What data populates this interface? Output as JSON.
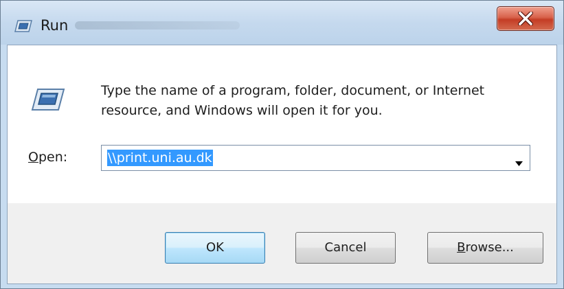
{
  "window": {
    "title": "Run"
  },
  "dialog": {
    "description_line1": "Type the name of a program, folder, document, or Internet",
    "description_line2": "resource, and Windows will open it for you.",
    "open_label_accel": "O",
    "open_label_rest": "pen:",
    "open_value": "\\\\print.uni.au.dk"
  },
  "buttons": {
    "ok_label": "OK",
    "cancel_label": "Cancel",
    "browse_accel": "B",
    "browse_rest": "rowse..."
  },
  "icons": {
    "title": "run-icon",
    "dialog": "run-icon",
    "close": "close-icon",
    "dropdown": "dropdown-arrow-icon"
  },
  "colors": {
    "selection": "#3399ff",
    "close_button": "#c43d25",
    "title_bar": "#c5d9ee"
  }
}
